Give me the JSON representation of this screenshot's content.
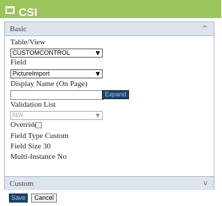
{
  "window": {
    "title": "CSI",
    "icon": "window-icon"
  },
  "accordion": {
    "basic_header": "Basic",
    "custom_header": "Custom",
    "basic_chevron": "^",
    "custom_chevron": "v"
  },
  "form": {
    "table_view_label": "Table/View",
    "table_view_value": "CUSTOMCONTROL",
    "field_label": "Field",
    "field_value": "PictureImport",
    "display_name_label": "Display Name (On Page)",
    "display_name_value": "",
    "expand_button": "Expand",
    "validation_list_label": "Validation List",
    "validation_list_value": "N/A",
    "override_label": "Override",
    "override_checked": false,
    "field_type_text": "Field Type Custom",
    "field_size_text": "Field Size 30",
    "multi_instance_text": "Multi-Instance No"
  },
  "actions": {
    "save_label": "Save",
    "cancel_label": "Cancel"
  },
  "colors": {
    "title_bar": "#9bc55a",
    "dark_button": "#1f4465",
    "accordion_header": "#dde4ee"
  }
}
